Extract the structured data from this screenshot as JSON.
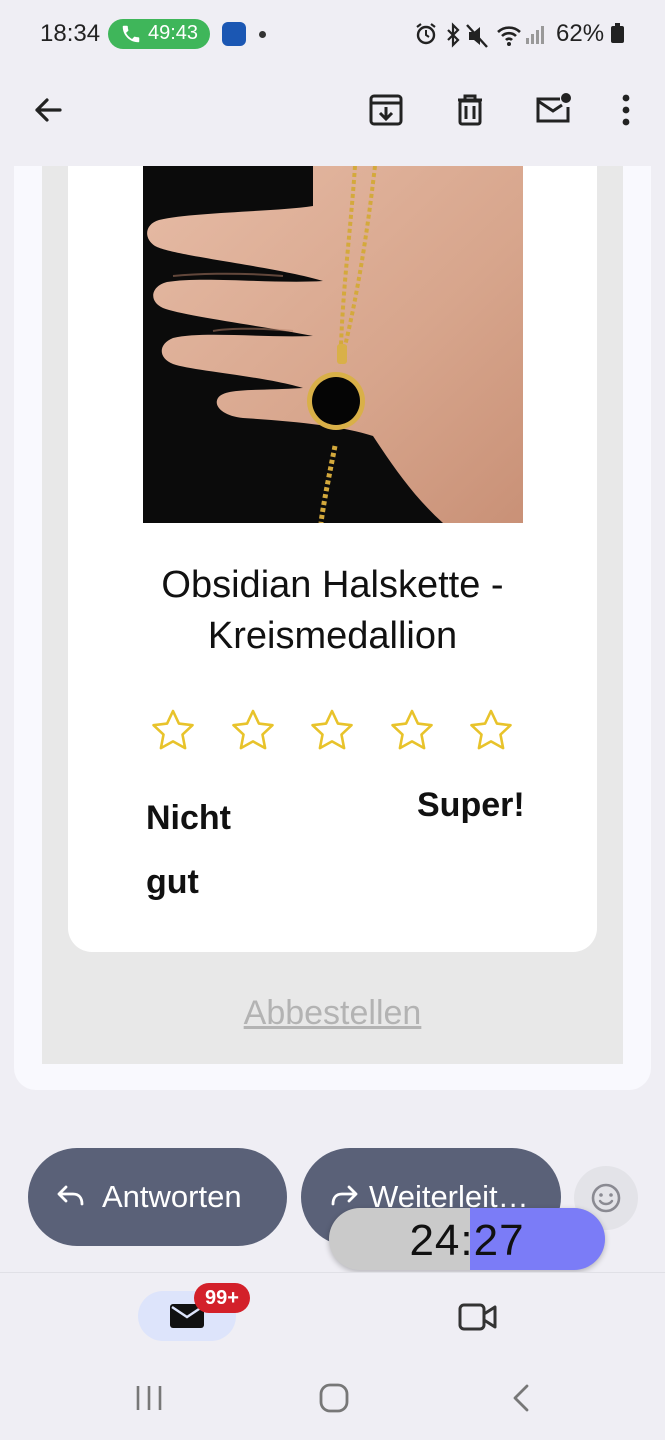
{
  "status_bar": {
    "time": "18:34",
    "call_timer": "49:43",
    "battery": "62%"
  },
  "toolbar": {
    "back_icon": "arrow-left-icon",
    "archive_icon": "archive-icon",
    "delete_icon": "trash-icon",
    "unread_icon": "mark-unread-icon",
    "more_icon": "more-vert-icon"
  },
  "email": {
    "product_title": "Obsidian Halskette - Kreismedallion",
    "rating": {
      "stars": 5,
      "star_color": "#e8c32b",
      "label_low": "Nicht gut",
      "label_high": "Super!"
    },
    "unsubscribe": "Abbestellen"
  },
  "actions": {
    "reply_label": "Antworten",
    "forward_label": "Weiterleit…",
    "emoji_icon": "emoji-icon"
  },
  "timer": {
    "text": "24:27",
    "progress": 0.49
  },
  "bottom_nav": {
    "mail_badge": "99+",
    "mail_icon": "mail-icon",
    "video_icon": "video-icon"
  },
  "colors": {
    "pill": "#5a6178",
    "badge": "#d3202a",
    "accent": "#7b7cf7"
  }
}
